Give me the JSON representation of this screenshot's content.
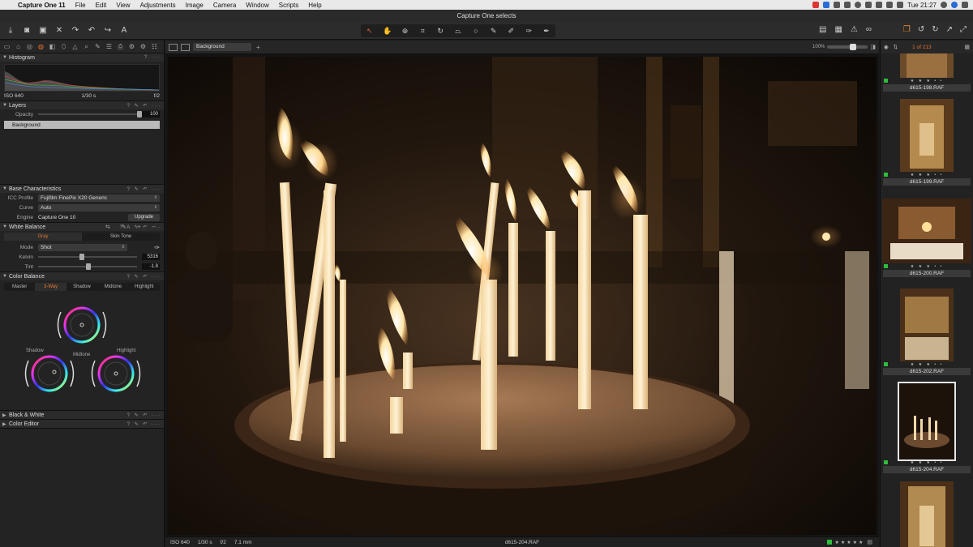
{
  "menubar": {
    "app_name": "Capture One 11",
    "items": [
      "File",
      "Edit",
      "View",
      "Adjustments",
      "Image",
      "Camera",
      "Window",
      "Scripts",
      "Help"
    ],
    "clock": "Tue 21:27"
  },
  "window_title": "Capture One selects",
  "left_panel": {
    "histogram": {
      "title": "Histogram",
      "iso": "ISO 640",
      "shutter": "1/30 s",
      "aperture": "f/2"
    },
    "layers": {
      "title": "Layers",
      "opacity_label": "Opacity",
      "opacity_value": "100",
      "selected_layer": "Background"
    },
    "base": {
      "title": "Base Characteristics",
      "icc_label": "ICC Profile",
      "icc_value": "Fujifilm FinePix X20 Generic",
      "curve_label": "Curve",
      "curve_value": "Auto",
      "engine_label": "Engine",
      "engine_value": "Capture One 10",
      "upgrade_label": "Upgrade"
    },
    "white_balance": {
      "title": "White Balance",
      "tab_gray": "Gray",
      "tab_skin": "Skin Tone",
      "mode_label": "Mode",
      "mode_value": "Shot",
      "kelvin_label": "Kelvin",
      "kelvin_value": "5316",
      "kelvin_level": 0.42,
      "tint_label": "Tint",
      "tint_value": "-1.8",
      "tint_level": 0.48
    },
    "color_balance": {
      "title": "Color Balance",
      "tabs": [
        "Master",
        "3-Way",
        "Shadow",
        "Midtone",
        "Highlight"
      ],
      "active_tab": 1,
      "shadow_label": "Shadow",
      "midtone_label": "Midtone",
      "highlight_label": "Highlight"
    },
    "bw": {
      "title": "Black & White"
    },
    "color_editor": {
      "title": "Color Editor"
    }
  },
  "viewer": {
    "layer_dropdown": "Background",
    "zoom": "100%",
    "status": {
      "iso": "ISO 640",
      "shutter": "1/30 s",
      "aperture": "f/2",
      "focal": "7.1 mm",
      "filename": "d615-204.RAF"
    }
  },
  "browser": {
    "count": "1 of 213",
    "thumbs": [
      {
        "name": "",
        "stars": "★ ★ ★ • •"
      },
      {
        "name": "d615-198.RAF",
        "stars": "★ ★ ★ • •"
      },
      {
        "name": "d615-199.RAF",
        "stars": "★ ★ ★ • •"
      },
      {
        "name": "d615-200.RAF",
        "stars": "★ ★ ★ • •"
      },
      {
        "name": "d615-202.RAF",
        "stars": "★ ★ ★ • •"
      },
      {
        "name": "d615-204.RAF",
        "stars": "★ ★ ★ • •"
      }
    ]
  },
  "colors": {
    "accent": "#e8752c",
    "green_tag": "#2ebd3c"
  }
}
